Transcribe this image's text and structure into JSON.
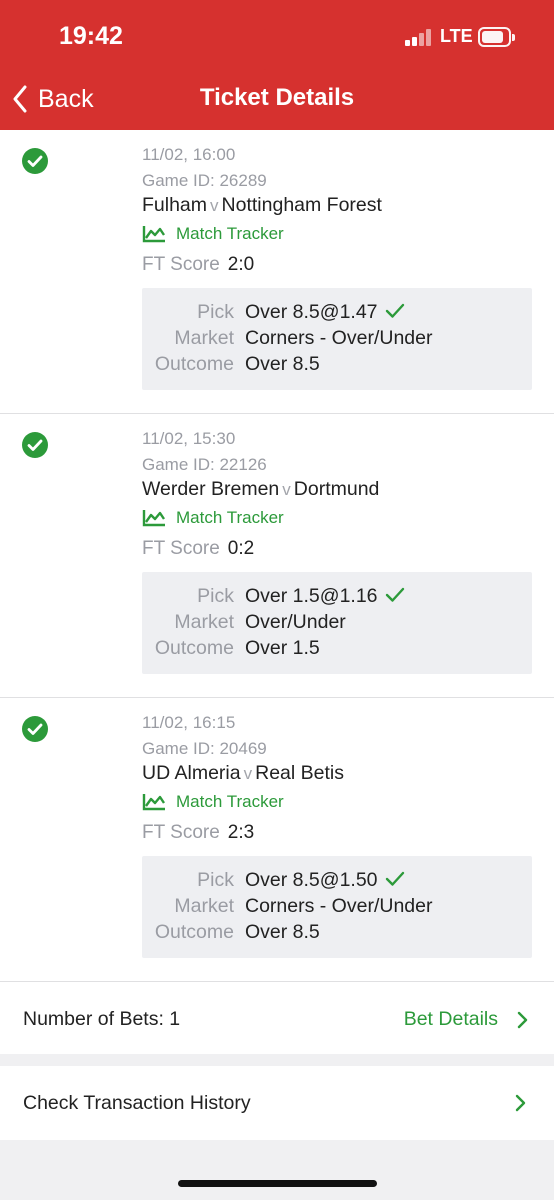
{
  "status_bar": {
    "time": "19:42",
    "network": "LTE"
  },
  "header": {
    "back_label": "Back",
    "title": "Ticket Details"
  },
  "theme": {
    "brand_red": "#d6312f",
    "success_green": "#2c9a3a"
  },
  "tickets": [
    {
      "datetime": "11/02, 16:00",
      "game_id": "Game ID: 26289",
      "home": "Fulham",
      "vs": "v",
      "away": "Nottingham Forest",
      "tracker_label": "Match Tracker",
      "score_label": "FT Score",
      "score": "2:0",
      "pick_label": "Pick",
      "pick": "Over 8.5@1.47",
      "market_label": "Market",
      "market": "Corners - Over/Under",
      "outcome_label": "Outcome",
      "outcome": "Over 8.5",
      "status_icon": "check-circle-icon"
    },
    {
      "datetime": "11/02, 15:30",
      "game_id": "Game ID: 22126",
      "home": "Werder Bremen",
      "vs": "v",
      "away": "Dortmund",
      "tracker_label": "Match Tracker",
      "score_label": "FT Score",
      "score": "0:2",
      "pick_label": "Pick",
      "pick": "Over 1.5@1.16",
      "market_label": "Market",
      "market": "Over/Under",
      "outcome_label": "Outcome",
      "outcome": "Over 1.5",
      "status_icon": "check-circle-icon"
    },
    {
      "datetime": "11/02, 16:15",
      "game_id": "Game ID: 20469",
      "home": "UD Almeria",
      "vs": "v",
      "away": "Real Betis",
      "tracker_label": "Match Tracker",
      "score_label": "FT Score",
      "score": "2:3",
      "pick_label": "Pick",
      "pick": "Over 8.5@1.50",
      "market_label": "Market",
      "market": "Corners - Over/Under",
      "outcome_label": "Outcome",
      "outcome": "Over 8.5",
      "status_icon": "check-circle-icon"
    }
  ],
  "summary": {
    "bets_count": "Number of Bets: 1",
    "bet_details_label": "Bet Details"
  },
  "history": {
    "label": "Check Transaction History"
  }
}
